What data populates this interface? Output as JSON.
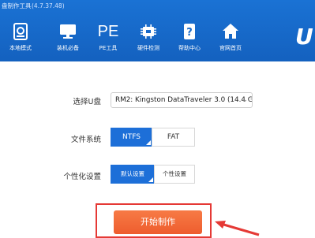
{
  "window": {
    "title": "盘制作工具",
    "version": "(4.7.37.48)"
  },
  "toolbar": {
    "items": [
      {
        "label": "本地模式",
        "icon": "local-mode-icon"
      },
      {
        "label": "装机必备",
        "icon": "monitor-icon"
      },
      {
        "label": "PE工具",
        "icon": "pe-icon"
      },
      {
        "label": "硬件检测",
        "icon": "hardware-chip-icon"
      },
      {
        "label": "帮助中心",
        "icon": "help-icon"
      },
      {
        "label": "官网首页",
        "icon": "home-icon"
      }
    ],
    "pe_glyph": "PE",
    "logo": "U"
  },
  "form": {
    "usb_label": "选择U盘",
    "usb_value": "RM2: Kingston DataTraveler 3.0 (14.4 G",
    "fs_label": "文件系统",
    "fs_options": [
      "NTFS",
      "FAT"
    ],
    "fs_selected": "NTFS",
    "personal_label": "个性化设置",
    "personal_options": [
      "默认设置",
      "个性设置"
    ],
    "personal_selected": "默认设置"
  },
  "action": {
    "start_label": "开始制作"
  },
  "colors": {
    "header": "#1769c9",
    "accent": "#1d6fd8",
    "start_button": "#f26b3a",
    "highlight": "#e53935"
  }
}
